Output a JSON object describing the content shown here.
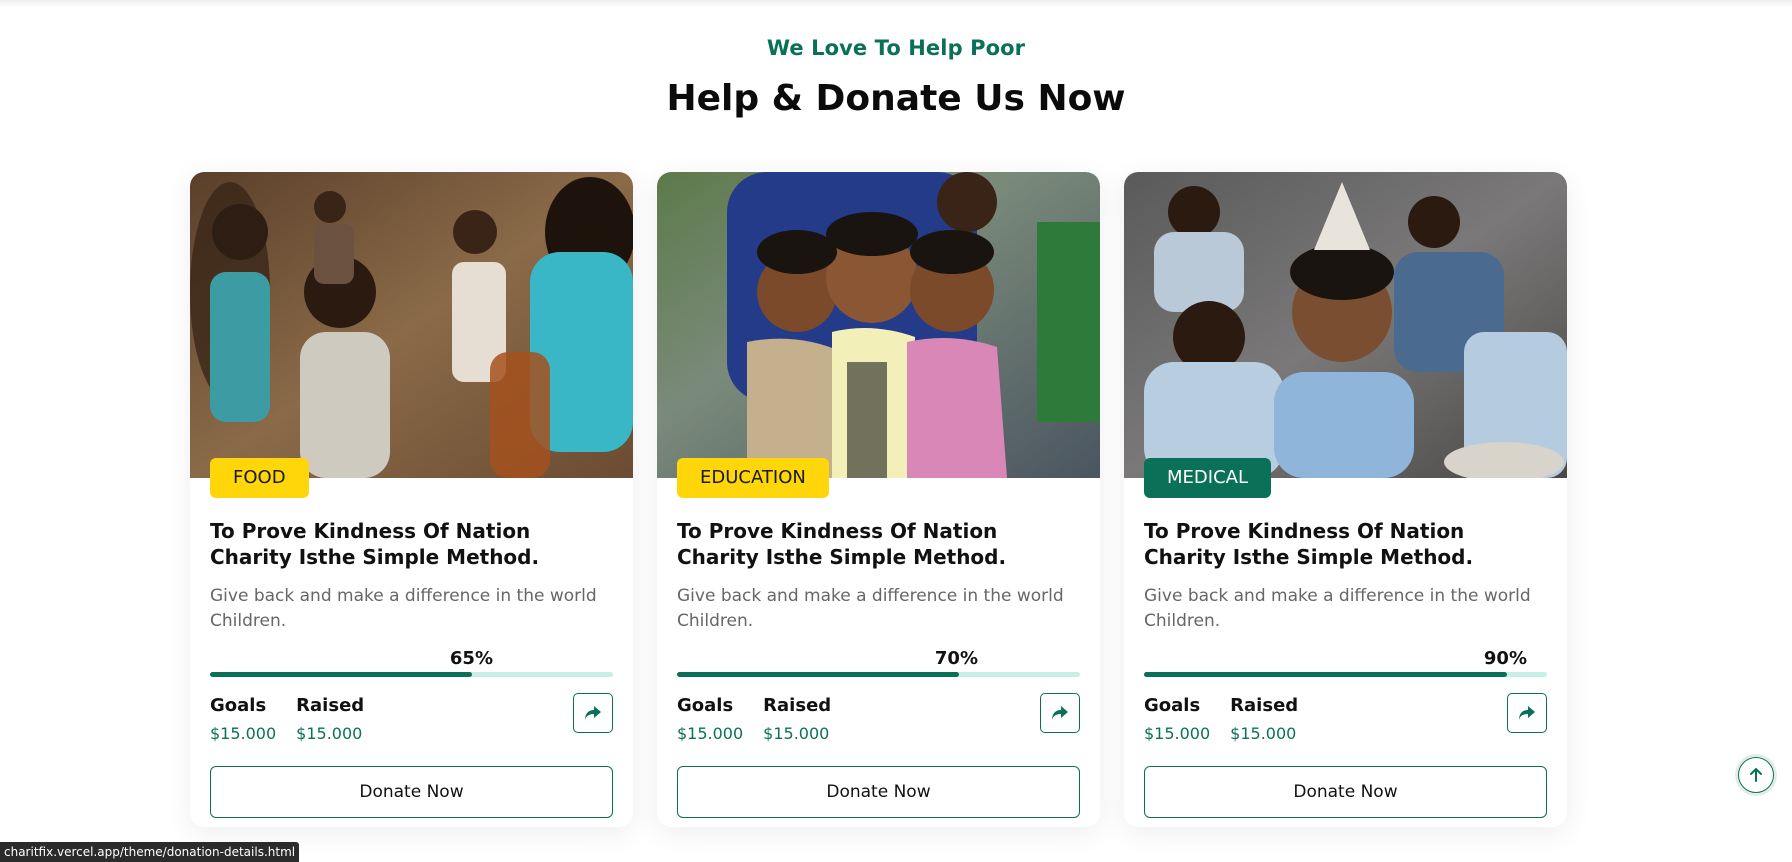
{
  "section": {
    "subtitle": "We Love To Help Poor",
    "title": "Help & Donate Us Now"
  },
  "cards": [
    {
      "tag": "FOOD",
      "tag_color": "#ffd60a",
      "title": "To Prove Kindness Of Nation Charity Isthe Simple Method.",
      "description": "Give back and make a difference in the world Children.",
      "progress": 0.65,
      "progress_label": "65%",
      "goals_label": "Goals",
      "goals_value": "$15.000",
      "raised_label": "Raised",
      "raised_value": "$15.000",
      "share_icon": "share-arrow-icon",
      "donate_label": "Donate Now"
    },
    {
      "tag": "EDUCATION",
      "tag_color": "#ffd60a",
      "title": "To Prove Kindness Of Nation Charity Isthe Simple Method.",
      "description": "Give back and make a difference in the world Children.",
      "progress": 0.7,
      "progress_label": "70%",
      "goals_label": "Goals",
      "goals_value": "$15.000",
      "raised_label": "Raised",
      "raised_value": "$15.000",
      "share_icon": "share-arrow-icon",
      "donate_label": "Donate Now"
    },
    {
      "tag": "MEDICAL",
      "tag_color": "#0a7158",
      "title": "To Prove Kindness Of Nation Charity Isthe Simple Method.",
      "description": "Give back and make a difference in the world Children.",
      "progress": 0.9,
      "progress_label": "90%",
      "goals_label": "Goals",
      "goals_value": "$15.000",
      "raised_label": "Raised",
      "raised_value": "$15.000",
      "share_icon": "share-arrow-icon",
      "donate_label": "Donate Now"
    }
  ],
  "status_bar": {
    "url": "charitfix.vercel.app/theme/donation-details.html"
  },
  "colors": {
    "accent": "#0a7158",
    "accent_light": "#c6efe5",
    "tag_yellow": "#ffd60a"
  }
}
